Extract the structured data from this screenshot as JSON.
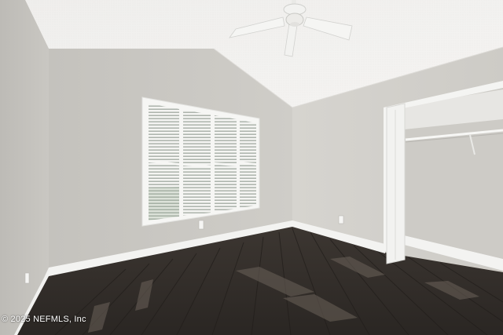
{
  "photo": {
    "watermark": "© 2025 NEFMLS, Inc"
  },
  "colors": {
    "ceiling": "#f2f1ef",
    "wall_left": "#c6c4bf",
    "wall_back": "#cbc9c4",
    "wall_right": "#d3d1cc",
    "closet_interior": "#c9c7c2",
    "baseboard": "#f4f4f2",
    "floor_dark": "#2e2a27",
    "floor_mid": "#4a433d",
    "window_shutter": "#f7f7f5",
    "fan_white": "#f5f5f3"
  }
}
